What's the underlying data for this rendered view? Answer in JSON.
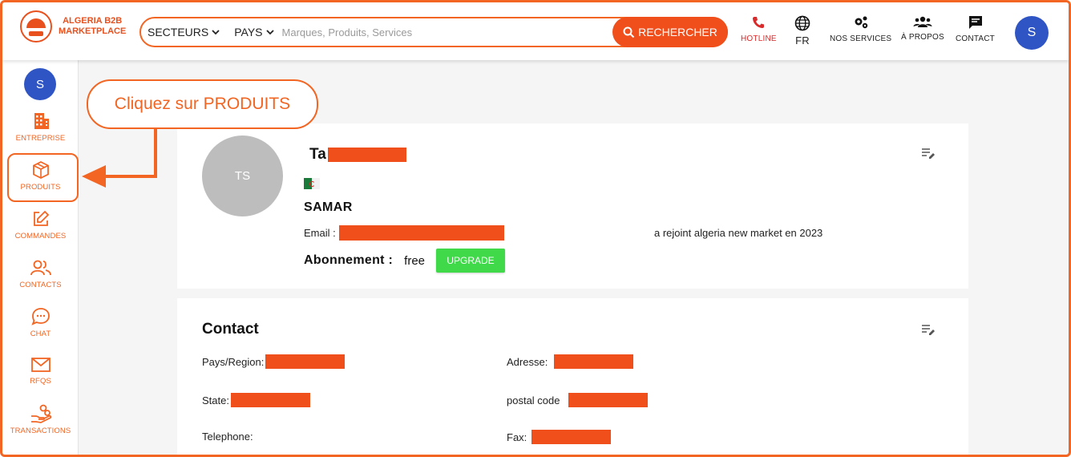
{
  "header": {
    "logo_line1": "ALGERIA B2B",
    "logo_line2": "MARKETPLACE",
    "secteurs_label": "SECTEURS",
    "pays_label": "PAYS",
    "search_placeholder": "Marques, Produits, Services",
    "search_button": "RECHERCHER",
    "nav": {
      "hotline": "HOTLINE",
      "language": "FR",
      "services": "NOS SERVICES",
      "about": "À PROPOS",
      "contact": "CONTACT"
    },
    "avatar_initial": "S"
  },
  "sidebar": {
    "avatar_initial": "S",
    "items": [
      {
        "label": "ENTREPRISE"
      },
      {
        "label": "PRODUITS"
      },
      {
        "label": "COMMANDES"
      },
      {
        "label": "CONTACTS"
      },
      {
        "label": "CHAT"
      },
      {
        "label": "RFQS"
      },
      {
        "label": "TRANSACTIONS"
      }
    ]
  },
  "callout": {
    "text": "Cliquez sur PRODUITS"
  },
  "profile": {
    "avatar_initials": "TS",
    "name_prefix": "Ta",
    "company": "SAMAR",
    "email_label": "Email :",
    "joined_text": "a rejoint algeria new market en 2023",
    "subscription_label": "Abonnement :",
    "subscription_value": "free",
    "upgrade_button": "UPGRADE"
  },
  "contact": {
    "title": "Contact",
    "fields": {
      "pays_region": "Pays/Region:",
      "adresse": "Adresse:",
      "state": "State:",
      "postal_code": "postal code",
      "telephone": "Telephone:",
      "fax": "Fax:"
    }
  },
  "colors": {
    "accent": "#f26522",
    "avatar_blue": "#2f55c4",
    "upgrade_green": "#3fd94a",
    "redaction": "#f04e1b"
  }
}
